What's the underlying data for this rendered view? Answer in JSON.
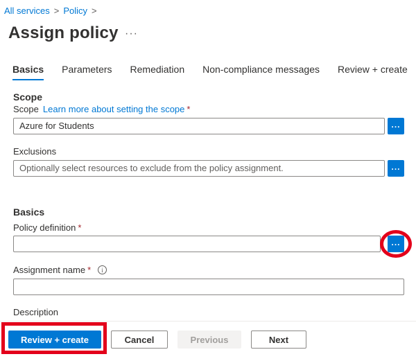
{
  "breadcrumb": {
    "items": [
      "All services",
      "Policy"
    ],
    "separator": ">"
  },
  "page": {
    "title": "Assign policy",
    "more": "···"
  },
  "tabs": [
    {
      "label": "Basics",
      "active": true
    },
    {
      "label": "Parameters"
    },
    {
      "label": "Remediation"
    },
    {
      "label": "Non-compliance messages"
    },
    {
      "label": "Review + create"
    }
  ],
  "scope_section": {
    "heading": "Scope",
    "scope_label": "Scope",
    "scope_link": "Learn more about setting the scope",
    "required_mark": "*",
    "scope_value": "Azure for Students",
    "exclusions_label": "Exclusions",
    "exclusions_placeholder": "Optionally select resources to exclude from the policy assignment."
  },
  "basics_section": {
    "heading": "Basics",
    "policy_definition_label": "Policy definition",
    "policy_definition_value": "",
    "assignment_name_label": "Assignment name",
    "assignment_name_value": "",
    "description_label": "Description",
    "required_mark": "*",
    "info_glyph": "i"
  },
  "browse_button": {
    "label": "..."
  },
  "footer": {
    "review_create": "Review + create",
    "cancel": "Cancel",
    "previous": "Previous",
    "next": "Next"
  },
  "colors": {
    "accent": "#0078d4",
    "highlight": "#e3001b",
    "required": "#a4262c"
  }
}
